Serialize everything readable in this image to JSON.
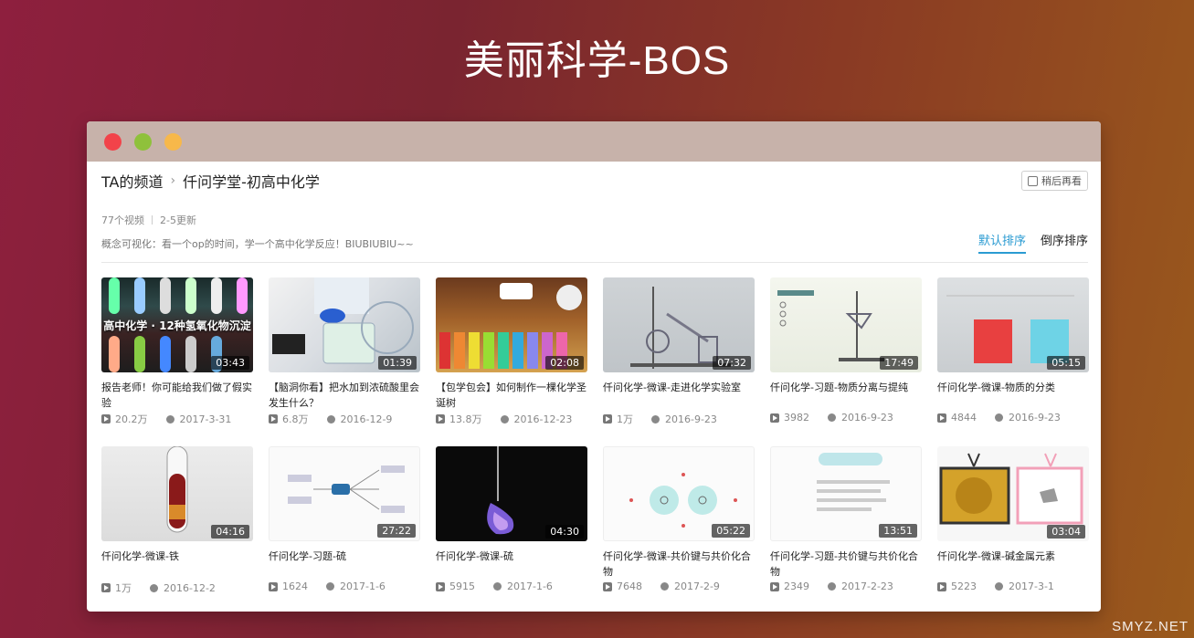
{
  "hero": {
    "title": "美丽科学-BOS"
  },
  "header": {
    "channel": "TA的频道",
    "playlist": "仟问学堂-初高中化学",
    "watch_later": "稍后再看"
  },
  "meta": {
    "count": "77个视频",
    "updated": "2-5更新",
    "description": "概念可视化：看一个op的时间，学一个高中化学反应！BIUBIUBIU~~"
  },
  "sort": {
    "default": "默认排序",
    "reverse": "倒序排序"
  },
  "videos": [
    {
      "title": "报告老师！你可能给我们做了假实验",
      "duration": "03:43",
      "views": "20.2万",
      "date": "2017-3-31",
      "thumb_text": "高中化学 · 12种氢氧化物沉淀"
    },
    {
      "title": "【脑洞你看】把水加到浓硫酸里会发生什么？",
      "duration": "01:39",
      "views": "6.8万",
      "date": "2016-12-9"
    },
    {
      "title": "【包学包会】如何制作一棵化学圣诞树",
      "duration": "02:08",
      "views": "13.8万",
      "date": "2016-12-23"
    },
    {
      "title": "仟问化学-微课-走进化学实验室",
      "duration": "07:32",
      "views": "1万",
      "date": "2016-9-23"
    },
    {
      "title": "仟问化学-习题-物质分离与提纯",
      "duration": "17:49",
      "views": "3982",
      "date": "2016-9-23"
    },
    {
      "title": "仟问化学-微课-物质的分类",
      "duration": "05:15",
      "views": "4844",
      "date": "2016-9-23"
    },
    {
      "title": "仟问化学-微课-铁",
      "duration": "04:16",
      "views": "1万",
      "date": "2016-12-2"
    },
    {
      "title": "仟问化学-习题-硫",
      "duration": "27:22",
      "views": "1624",
      "date": "2017-1-6"
    },
    {
      "title": "仟问化学-微课-硫",
      "duration": "04:30",
      "views": "5915",
      "date": "2017-1-6"
    },
    {
      "title": "仟问化学-微课-共价键与共价化合物",
      "duration": "05:22",
      "views": "7648",
      "date": "2017-2-9"
    },
    {
      "title": "仟问化学-习题-共价键与共价化合物",
      "duration": "13:51",
      "views": "2349",
      "date": "2017-2-23"
    },
    {
      "title": "仟问化学-微课-碱金属元素",
      "duration": "03:04",
      "views": "5223",
      "date": "2017-3-1"
    }
  ],
  "watermark": "SMYZ.NET"
}
